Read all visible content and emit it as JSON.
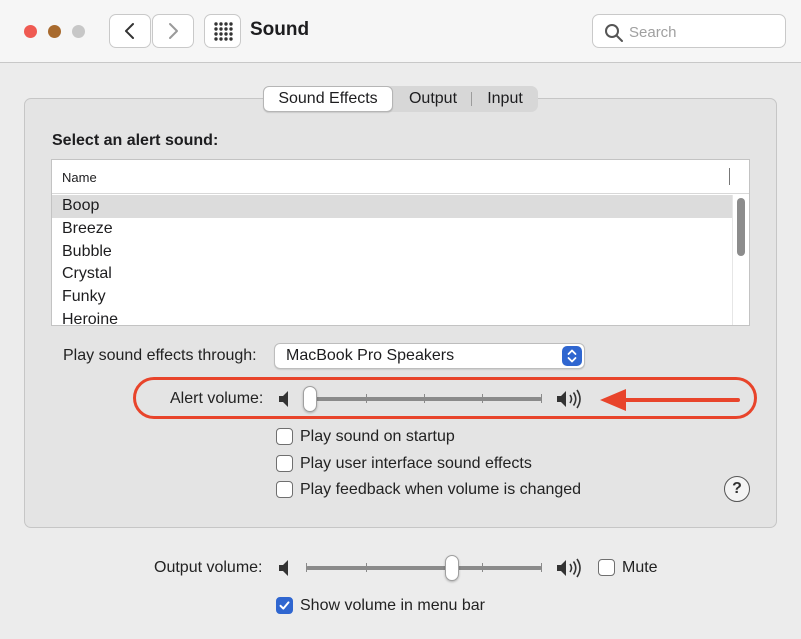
{
  "window": {
    "title": "Sound",
    "search_placeholder": "Search",
    "traffic_lights": {
      "close": "#ef5a52",
      "minimize": "#a86a2e",
      "zoom": "#c7c7c7"
    },
    "icons": {
      "back": "chevron-left",
      "forward": "chevron-right",
      "grid": "grid-icon",
      "search": "magnifier"
    }
  },
  "tabs": [
    {
      "label": "Sound Effects",
      "active": true
    },
    {
      "label": "Output",
      "active": false
    },
    {
      "label": "Input",
      "active": false
    }
  ],
  "alert_section": {
    "heading": "Select an alert sound:",
    "column_header": "Name",
    "sounds": [
      "Boop",
      "Breeze",
      "Bubble",
      "Crystal",
      "Funky",
      "Heroine"
    ],
    "selected": "Boop"
  },
  "play_through": {
    "label": "Play sound effects through:",
    "value": "MacBook Pro Speakers"
  },
  "alert_volume": {
    "label": "Alert volume:",
    "level": 0.0,
    "ticks": 5,
    "highlight_color": "#e8442b"
  },
  "options": [
    {
      "label": "Play sound on startup",
      "checked": false
    },
    {
      "label": "Play user interface sound effects",
      "checked": false
    },
    {
      "label": "Play feedback when volume is changed",
      "checked": false
    }
  ],
  "help": "?",
  "output_volume": {
    "label": "Output volume:",
    "level": 0.6,
    "ticks": 5,
    "mute_label": "Mute",
    "muted": false
  },
  "menu_bar": {
    "label": "Show volume in menu bar",
    "checked": true
  },
  "accent_color": "#2f66d0"
}
